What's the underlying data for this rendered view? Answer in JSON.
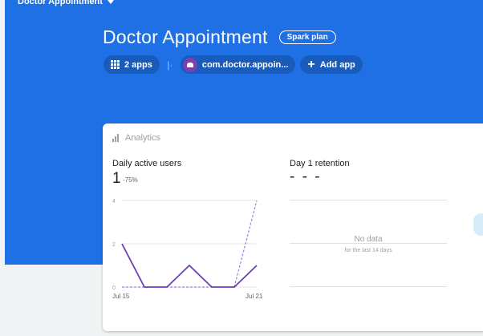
{
  "project_switcher": {
    "label": "Doctor Appointment"
  },
  "header": {
    "title": "Doctor Appointment",
    "plan_badge": "Spark plan",
    "apps_chip": "2 apps",
    "app_package": "com.doctor.appoin...",
    "add_app": "Add app"
  },
  "card": {
    "title": "Analytics",
    "daily_active_users": {
      "label": "Daily active users",
      "value": "1",
      "delta": "-75%"
    },
    "retention": {
      "label": "Day 1 retention",
      "value": "- - -",
      "no_data": "No data",
      "no_data_sub": "for the last 14 days"
    }
  },
  "colors": {
    "hero": "#1f6fe5",
    "series_current": "#6a3fb5",
    "series_previous": "#9c7fe0"
  },
  "chart_data": {
    "type": "line",
    "x_labels": [
      "Jul 15",
      "Jul 21"
    ],
    "ylim": [
      0,
      4
    ],
    "y_ticks": [
      "4",
      "2",
      "0"
    ],
    "series": [
      {
        "style": "solid",
        "values": [
          2,
          0,
          0,
          1,
          0,
          0,
          1
        ]
      },
      {
        "style": "dashed",
        "values": [
          0,
          0,
          0,
          0,
          0,
          0,
          4
        ]
      }
    ]
  }
}
